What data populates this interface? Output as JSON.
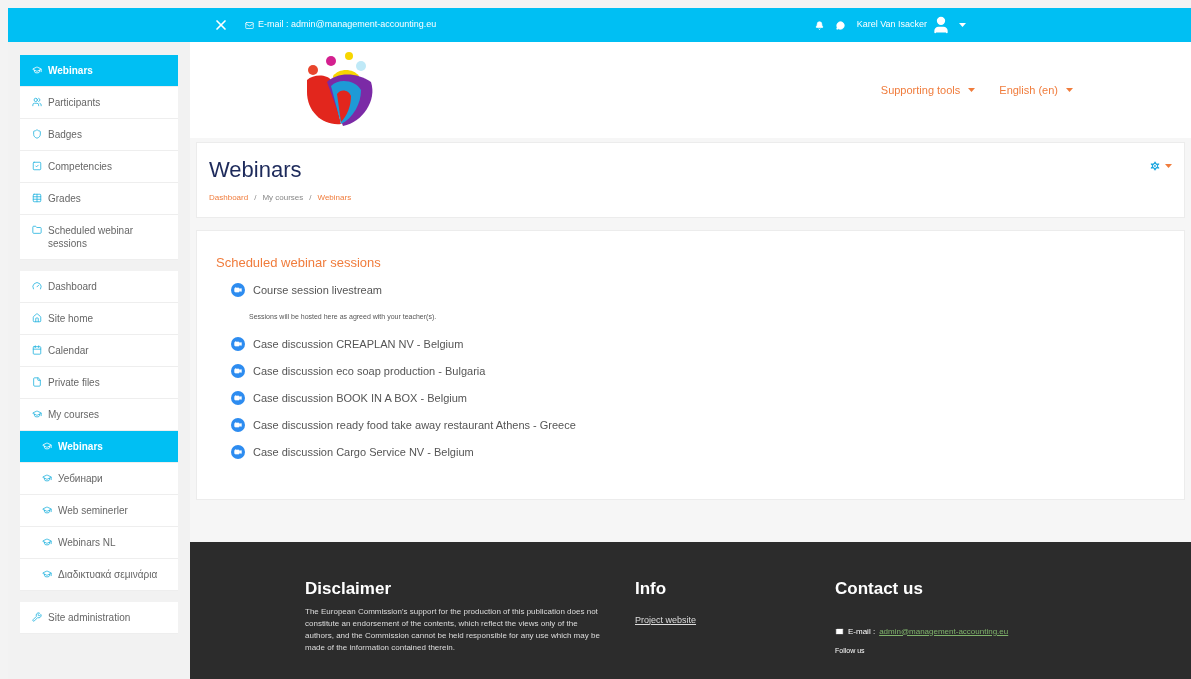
{
  "top_bar": {
    "email_label": "E-mail : admin@management-accounting.eu",
    "user_name": "Karel Van Isacker"
  },
  "sidebar": {
    "blocks": [
      [
        {
          "label": "Webinars",
          "selected": true
        },
        {
          "label": "Participants",
          "selected": false
        },
        {
          "label": "Badges",
          "selected": false
        },
        {
          "label": "Competencies",
          "selected": false
        },
        {
          "label": "Grades",
          "selected": false
        },
        {
          "label": "Scheduled webinar sessions",
          "selected": false
        }
      ],
      [
        {
          "label": "Dashboard",
          "selected": false
        },
        {
          "label": "Site home",
          "selected": false
        },
        {
          "label": "Calendar",
          "selected": false
        },
        {
          "label": "Private files",
          "selected": false
        },
        {
          "label": "My courses",
          "selected": false,
          "children": [
            {
              "label": "Webinars",
              "selected": true
            },
            {
              "label": "Уебинари",
              "selected": false
            },
            {
              "label": "Web seminerler",
              "selected": false
            },
            {
              "label": "Webinars NL",
              "selected": false
            },
            {
              "label": "Διαδικτυακά σεμινάρια",
              "selected": false
            }
          ]
        }
      ],
      [
        {
          "label": "Site administration",
          "selected": false
        }
      ]
    ]
  },
  "header_nav": [
    "Supporting tools",
    "English (en)"
  ],
  "page_header": {
    "title": "Webinars",
    "separator": "/",
    "breadcrumb": [
      {
        "label": "Dashboard",
        "kind": "link"
      },
      {
        "label": "My courses",
        "kind": "text"
      },
      {
        "label": "Webinars",
        "kind": "link"
      }
    ]
  },
  "section": {
    "title": "Scheduled webinar sessions",
    "items": [
      {
        "kind": "activity",
        "label": "Course session livestream"
      },
      {
        "kind": "note",
        "label": "Sessions will be hosted here as agreed with your teacher(s)."
      },
      {
        "kind": "activity",
        "label": "Case discussion CREAPLAN NV - Belgium"
      },
      {
        "kind": "activity",
        "label": "Case discussion eco soap production - Bulgaria"
      },
      {
        "kind": "activity",
        "label": "Case discussion BOOK IN A BOX - Belgium"
      },
      {
        "kind": "activity",
        "label": "Case discussion ready food take away restaurant Athens - Greece"
      },
      {
        "kind": "activity",
        "label": "Case discussion Cargo Service NV - Belgium"
      }
    ]
  },
  "footer": {
    "disclaimer": {
      "title": "Disclaimer",
      "text": "The European Commission's support for the production of this publication does not constitute an endorsement of the contents, which reflect the views only of the authors, and the Commission cannot be held responsible for any use which may be made of the information contained therein."
    },
    "info": {
      "title": "Info",
      "link": "Project website"
    },
    "contact": {
      "title": "Contact us",
      "email_label": "E-mail :",
      "email": "admin@management-accounting.eu",
      "follow": "Follow us"
    }
  }
}
